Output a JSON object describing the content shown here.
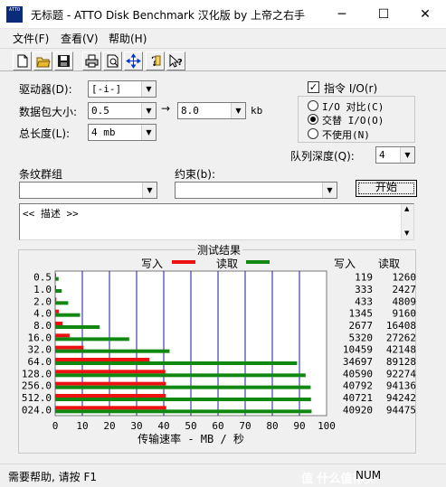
{
  "window": {
    "title": "无标题 - ATTO Disk Benchmark 汉化版 by 上帝之右手",
    "icon_text": "ATTO",
    "minimize": "─",
    "maximize": "☐",
    "close": "✕"
  },
  "menu": {
    "file": "文件(F)",
    "view": "查看(V)",
    "help": "帮助(H)"
  },
  "toolbar": {
    "icons": [
      "new-file-icon",
      "open-folder-icon",
      "save-icon",
      "print-icon",
      "print-preview-icon",
      "move-icon",
      "help-icon",
      "context-help-icon"
    ]
  },
  "settings": {
    "drive_label": "驱动器(D):",
    "drive_value": "[-i-]",
    "packet_label": "数据包大小:",
    "packet_from": "0.5",
    "packet_to": "8.0",
    "packet_arrow": "→",
    "packet_unit": "kb",
    "length_label": "总长度(L):",
    "length_value": "4 mb",
    "direct_io_label": "指令 I/O(r)",
    "direct_io_checked": "✓",
    "io_compare_label": "I/O 对比(C)",
    "overlap_io_label": "交替 I/O(O)",
    "no_use_label": "不使用(N)",
    "queue_label": "队列深度(Q):",
    "queue_value": "4",
    "stripe_label": "条纹群组",
    "constraint_label": "约束(b):",
    "start_button": "开始",
    "description": "<< 描述 >>"
  },
  "results": {
    "group_title": "测试结果",
    "legend_write": "写入",
    "legend_read": "读取",
    "col_write": "写入",
    "col_read": "读取",
    "xlabel": "传输速率 - MB / 秒"
  },
  "colors": {
    "write": "#ee1111",
    "read": "#118811",
    "grid": "#1a1aa8"
  },
  "chart_data": {
    "type": "bar",
    "orientation": "horizontal",
    "categories": [
      "0.5",
      "1.0",
      "2.0",
      "4.0",
      "8.0",
      "16.0",
      "32.0",
      "64.0",
      "128.0",
      "256.0",
      "512.0",
      "024.0"
    ],
    "series": [
      {
        "name": "写入",
        "values": [
          119,
          333,
          433,
          1345,
          2677,
          5320,
          10459,
          34697,
          40590,
          40792,
          40721,
          40920
        ]
      },
      {
        "name": "读取",
        "values": [
          1260,
          2427,
          4809,
          9160,
          16408,
          27262,
          42148,
          89128,
          92274,
          94136,
          94242,
          94475
        ]
      }
    ],
    "xticks": [
      "0",
      "10",
      "20",
      "30",
      "40",
      "50",
      "60",
      "70",
      "80",
      "90",
      "100"
    ],
    "xlim": [
      0,
      100
    ],
    "unit_scale": 1000,
    "xlabel": "传输速率 - MB / 秒"
  },
  "status": {
    "help_text": "需要帮助, 请按 F1",
    "num": "NUM",
    "watermark": "值 什么值得买"
  }
}
